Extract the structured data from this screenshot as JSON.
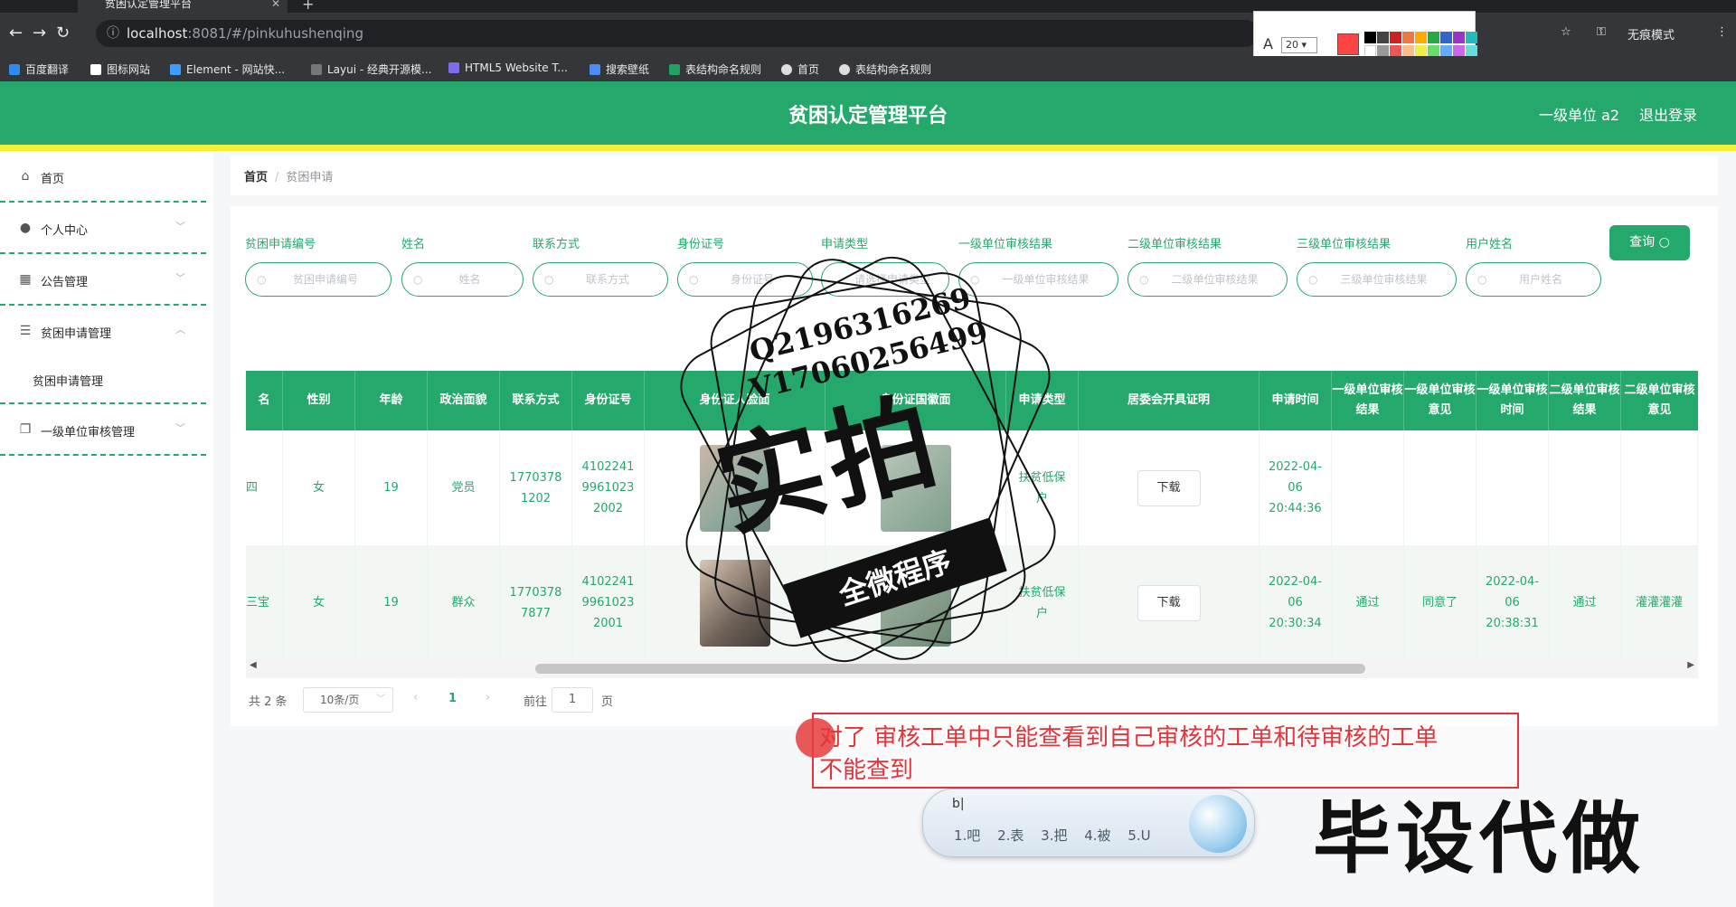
{
  "browser": {
    "tab_title": "贫困认定管理平台",
    "url_host": "localhost",
    "url_rest": ":8081/#/pinkuhushenqing",
    "incognito_label": "无痕模式",
    "annot_font_size": "20",
    "bookmarks": [
      "百度翻译",
      "图标网站",
      "Element - 网站快...",
      "Layui - 经典开源模...",
      "HTML5 Website T...",
      "搜索壁纸",
      "表结构命名规则",
      "首页",
      "表结构命名规则"
    ]
  },
  "header": {
    "title": "贫困认定管理平台",
    "user": "一级单位 a2",
    "logout": "退出登录",
    "bg_color": "#25a86c"
  },
  "sidebar": {
    "items": [
      {
        "label": "首页"
      },
      {
        "label": "个人中心"
      },
      {
        "label": "公告管理"
      },
      {
        "label": "贫困申请管理"
      },
      {
        "label": "贫困申请管理"
      },
      {
        "label": "一级单位审核管理"
      }
    ]
  },
  "breadcrumb": {
    "home": "首页",
    "sep": "/",
    "current": "贫困申请"
  },
  "filters": [
    {
      "label": "贫困申请编号",
      "placeholder": "贫困申请编号"
    },
    {
      "label": "姓名",
      "placeholder": "姓名"
    },
    {
      "label": "联系方式",
      "placeholder": "联系方式"
    },
    {
      "label": "身份证号",
      "placeholder": "身份证号"
    },
    {
      "label": "申请类型",
      "placeholder": "请选择申请类型"
    },
    {
      "label": "一级单位审核结果",
      "placeholder": "一级单位审核结果"
    },
    {
      "label": "二级单位审核结果",
      "placeholder": "二级单位审核结果"
    },
    {
      "label": "三级单位审核结果",
      "placeholder": "三级单位审核结果"
    },
    {
      "label": "用户姓名",
      "placeholder": "用户姓名"
    }
  ],
  "query_button": "查询",
  "table": {
    "headers": [
      "名",
      "性别",
      "年龄",
      "政治面貌",
      "联系方式",
      "身份证号",
      "身份证人脸面",
      "身份证国徽面",
      "申请类型",
      "居委会开具证明",
      "申请时间",
      "一级单位审核结果",
      "一级单位审核意见",
      "一级单位审核时间",
      "二级单位审核结果",
      "二级单位审核意见"
    ],
    "rows": [
      {
        "name": "四",
        "gender": "女",
        "age": "19",
        "political": "党员",
        "phone": "17703781202",
        "id_no": "410224199610232002",
        "type": "扶贫低保户",
        "proof": "下载",
        "apply_time": "2022-04-06 20:44:36",
        "l1_result": "",
        "l1_opinion": "",
        "l1_time": "",
        "l2_result": "",
        "l2_opinion": ""
      },
      {
        "name": "三宝",
        "gender": "女",
        "age": "19",
        "political": "群众",
        "phone": "17703787877",
        "id_no": "410224199610232001",
        "type": "扶贫低保户",
        "proof": "下载",
        "apply_time": "2022-04-06 20:30:34",
        "l1_result": "通过",
        "l1_opinion": "同意了",
        "l1_time": "2022-04-06 20:38:31",
        "l2_result": "通过",
        "l2_opinion": "灌灌灌灌"
      }
    ]
  },
  "pager": {
    "total": "共 2 条",
    "size": "10条/页",
    "page": "1",
    "goto": "前往",
    "goto_val": "1",
    "unit": "页"
  },
  "overlay": {
    "stamp_line1": "Q2196316269",
    "stamp_line2": "V17060256499",
    "stamp_big": "实拍",
    "stamp_banner": "全微程序",
    "note": "对了  审核工单中只能查看到自己审核的工单和待审核的工单\n不能查到",
    "ime_code": "b|",
    "ime_candidates": "1.吧 2.表 3.把 4.被 5.U",
    "ad_text": "毕设代做"
  }
}
